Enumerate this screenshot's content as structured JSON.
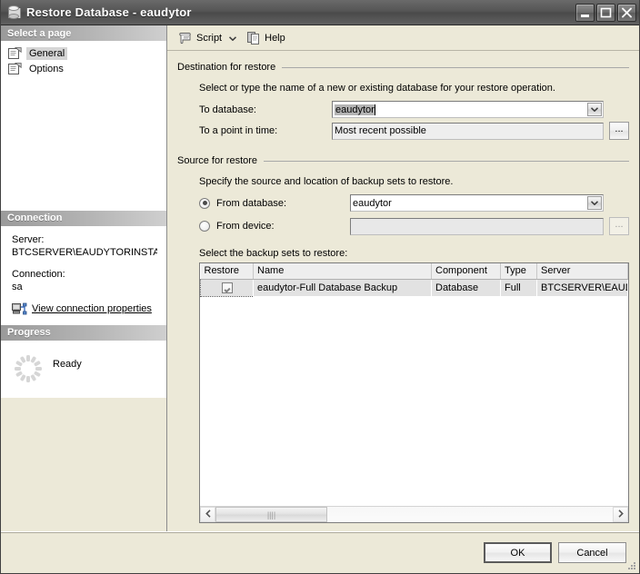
{
  "window": {
    "title": "Restore Database  -  eaudytor",
    "icon": "database-cylinder-icon",
    "minimize_label": "Minimize",
    "maximize_label": "Maximize",
    "close_label": "Close"
  },
  "sidebar": {
    "select_a_page_header": "Select a page",
    "pages": [
      {
        "label": "General",
        "icon": "page-icon",
        "selected": true
      },
      {
        "label": "Options",
        "icon": "page-icon",
        "selected": false
      }
    ],
    "connection": {
      "header": "Connection",
      "server_label": "Server:",
      "server_value": "BTCSERVER\\EAUDYTORINSTA",
      "connection_label": "Connection:",
      "connection_value": "sa",
      "properties_link": "View connection properties",
      "properties_icon": "server-connection-icon"
    },
    "progress": {
      "header": "Progress",
      "status": "Ready",
      "spinner_icon": "progress-spinner-icon"
    }
  },
  "toolbar": {
    "script_label": "Script",
    "script_icon": "script-scroll-icon",
    "script_caret_icon": "chevron-down-icon",
    "help_label": "Help",
    "help_icon": "help-pages-icon"
  },
  "destination_group": {
    "title": "Destination for restore",
    "hint": "Select or type the name of a new or existing database for your restore operation.",
    "to_database_label": "To database:",
    "to_database_value": "eaudytor",
    "to_database_selected": true,
    "to_point_in_time_label": "To a point in time:",
    "to_point_in_time_value": "Most recent possible",
    "browse_label": "..."
  },
  "source_group": {
    "title": "Source for restore",
    "hint": "Specify the source and location of backup sets to restore.",
    "from_database_label": "From database:",
    "from_database_value": "eaudytor",
    "from_database_checked": true,
    "from_device_label": "From device:",
    "from_device_value": "",
    "from_device_checked": false,
    "device_browse_label": "...",
    "grid_label": "Select the backup sets to restore:"
  },
  "grid": {
    "columns": [
      "Restore",
      "Name",
      "Component",
      "Type",
      "Server"
    ],
    "rows": [
      {
        "restore_checked": true,
        "name": "eaudytor-Full Database Backup",
        "component": "Database",
        "type": "Full",
        "server": "BTCSERVER\\EAUDYTORINS"
      }
    ],
    "scroll_left_icon": "chevron-left-icon",
    "scroll_right_icon": "chevron-right-icon",
    "thumb_grip_icon": "grip-icon"
  },
  "footer": {
    "ok_label": "OK",
    "cancel_label": "Cancel",
    "resize_grip_icon": "resize-grip-icon"
  },
  "colors": {
    "dialog_face": "#ece9d8",
    "titlebar": "#555555",
    "pane_header": "#b5b5b5",
    "selection": "#b4b4b4",
    "grid_row": "#e2e2e2"
  }
}
